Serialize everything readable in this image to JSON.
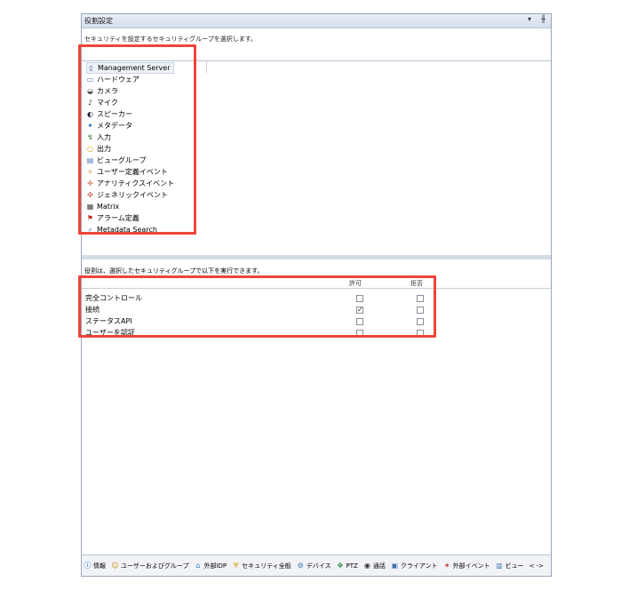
{
  "panel": {
    "title": "役割設定",
    "pin_icon": "pin-icon",
    "dock_label": "▾  ╫"
  },
  "instruction": "セキュリティを設定するセキュリティグループを選択します。",
  "tree_items": [
    {
      "label": "Management Server",
      "icon": "server-icon",
      "selected": true
    },
    {
      "label": "ハードウェア",
      "icon": "hardware-icon"
    },
    {
      "label": "カメラ",
      "icon": "camera-icon"
    },
    {
      "label": "マイク",
      "icon": "microphone-icon"
    },
    {
      "label": "スピーカー",
      "icon": "speaker-icon"
    },
    {
      "label": "メタデータ",
      "icon": "metadata-icon"
    },
    {
      "label": "入力",
      "icon": "input-icon"
    },
    {
      "label": "出力",
      "icon": "output-icon"
    },
    {
      "label": "ビューグループ",
      "icon": "view-group-icon"
    },
    {
      "label": "ユーザー定義イベント",
      "icon": "user-event-icon"
    },
    {
      "label": "アナリティクスイベント",
      "icon": "analytics-event-icon"
    },
    {
      "label": "ジェネリックイベント",
      "icon": "generic-event-icon"
    },
    {
      "label": "Matrix",
      "icon": "matrix-icon"
    },
    {
      "label": "アラーム定義",
      "icon": "alarm-icon"
    },
    {
      "label": "Metadata Search",
      "icon": "metadata-search-icon"
    }
  ],
  "permissions": {
    "description": "役割は、選択したセキュリティグループで以下を実行できます。",
    "col_allow": "許可",
    "col_deny": "拒否",
    "rows": [
      {
        "label": "完全コントロール",
        "allow": false,
        "deny": false
      },
      {
        "label": "接続",
        "allow": true,
        "deny": false
      },
      {
        "label": "ステータスAPI",
        "allow": false,
        "deny": false
      },
      {
        "label": "ユーザーを認証",
        "allow": false,
        "deny": false
      }
    ]
  },
  "bottom_tabs": [
    {
      "label": "情報",
      "icon": "info-icon"
    },
    {
      "label": "ユーザーおよびグループ",
      "icon": "users-icon"
    },
    {
      "label": "外部IDP",
      "icon": "external-idp-icon"
    },
    {
      "label": "セキュリティ全般",
      "icon": "security-icon"
    },
    {
      "label": "デバイス",
      "icon": "device-icon"
    },
    {
      "label": "PTZ",
      "icon": "ptz-icon"
    },
    {
      "label": "通話",
      "icon": "speech-icon"
    },
    {
      "label": "クライアント",
      "icon": "client-icon"
    },
    {
      "label": "外部イベント",
      "icon": "external-event-icon"
    },
    {
      "label": "ビュー",
      "icon": "view-icon"
    }
  ],
  "scroll_arrows": "< ->",
  "colors": {
    "highlight": "#f0443a",
    "accent": "#1f5fb8"
  }
}
